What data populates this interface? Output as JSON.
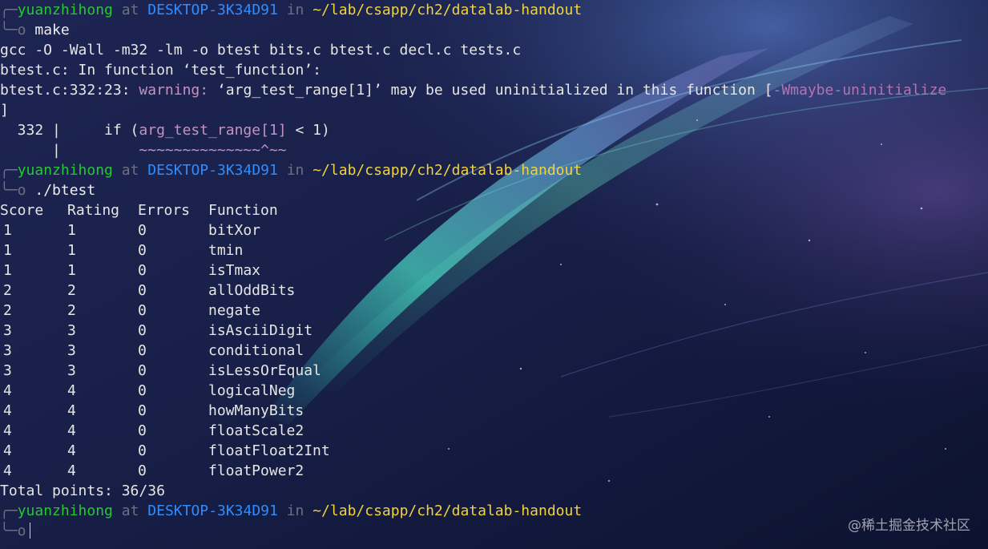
{
  "prompt": {
    "user": "yuanzhihong",
    "at": "at",
    "host": "DESKTOP-3K34D91",
    "in": "in",
    "path": "~/lab/csapp/ch2/datalab-handout",
    "branch": "╭─",
    "arrow": "╰─o"
  },
  "session": {
    "cmd1": " make",
    "gcc": "gcc -O -Wall -m32 -lm -o btest bits.c btest.c decl.c tests.c",
    "in_function": "btest.c: In function ‘test_function’:",
    "warn_loc": "btest.c:332:23: ",
    "warn_label": "warning: ",
    "warn_msg": "‘arg_test_range[1]’ may be used uninitialized in this function [",
    "warn_flag": "-Wmaybe-uninitialize",
    "bracket": "]",
    "src_lineno": "  332 |     if (",
    "src_var": "arg_test_range[1]",
    "src_rest": " < 1)",
    "src_bar": "      |         ",
    "src_squiggle": "~~~~~~~~~~~~~~^~~",
    "cmd2": " ./btest",
    "total": "Total points: 36/36"
  },
  "results": {
    "headers": [
      "Score",
      "Rating",
      "Errors",
      "Function"
    ],
    "rows": [
      {
        "score": "1",
        "rating": "1",
        "errors": "0",
        "function": "bitXor"
      },
      {
        "score": "1",
        "rating": "1",
        "errors": "0",
        "function": "tmin"
      },
      {
        "score": "1",
        "rating": "1",
        "errors": "0",
        "function": "isTmax"
      },
      {
        "score": "2",
        "rating": "2",
        "errors": "0",
        "function": "allOddBits"
      },
      {
        "score": "2",
        "rating": "2",
        "errors": "0",
        "function": "negate"
      },
      {
        "score": "3",
        "rating": "3",
        "errors": "0",
        "function": "isAsciiDigit"
      },
      {
        "score": "3",
        "rating": "3",
        "errors": "0",
        "function": "conditional"
      },
      {
        "score": "3",
        "rating": "3",
        "errors": "0",
        "function": "isLessOrEqual"
      },
      {
        "score": "4",
        "rating": "4",
        "errors": "0",
        "function": "logicalNeg"
      },
      {
        "score": "4",
        "rating": "4",
        "errors": "0",
        "function": "howManyBits"
      },
      {
        "score": "4",
        "rating": "4",
        "errors": "0",
        "function": "floatScale2"
      },
      {
        "score": "4",
        "rating": "4",
        "errors": "0",
        "function": "floatFloat2Int"
      },
      {
        "score": "4",
        "rating": "4",
        "errors": "0",
        "function": "floatPower2"
      }
    ]
  },
  "watermark": "@稀土掘金技术社区",
  "colors": {
    "user": "#26c832",
    "host": "#2f8cff",
    "path": "#f2d33a",
    "warning": "#c493c0",
    "background": "#141a3a"
  }
}
